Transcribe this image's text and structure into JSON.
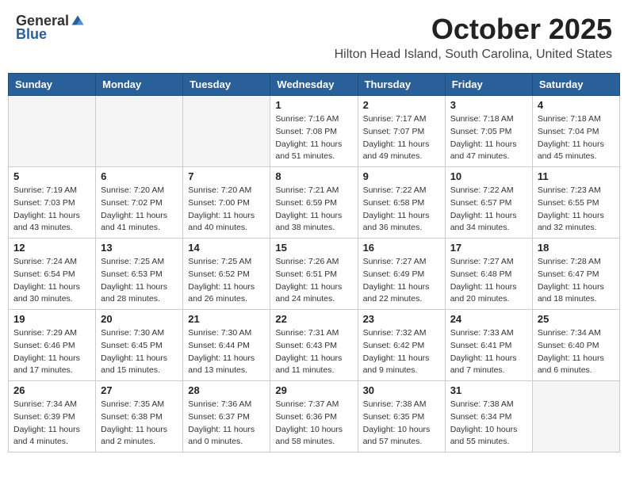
{
  "logo": {
    "general": "General",
    "blue": "Blue"
  },
  "title": "October 2025",
  "location": "Hilton Head Island, South Carolina, United States",
  "days_of_week": [
    "Sunday",
    "Monday",
    "Tuesday",
    "Wednesday",
    "Thursday",
    "Friday",
    "Saturday"
  ],
  "weeks": [
    [
      {
        "day": "",
        "info": ""
      },
      {
        "day": "",
        "info": ""
      },
      {
        "day": "",
        "info": ""
      },
      {
        "day": "1",
        "info": "Sunrise: 7:16 AM\nSunset: 7:08 PM\nDaylight: 11 hours\nand 51 minutes."
      },
      {
        "day": "2",
        "info": "Sunrise: 7:17 AM\nSunset: 7:07 PM\nDaylight: 11 hours\nand 49 minutes."
      },
      {
        "day": "3",
        "info": "Sunrise: 7:18 AM\nSunset: 7:05 PM\nDaylight: 11 hours\nand 47 minutes."
      },
      {
        "day": "4",
        "info": "Sunrise: 7:18 AM\nSunset: 7:04 PM\nDaylight: 11 hours\nand 45 minutes."
      }
    ],
    [
      {
        "day": "5",
        "info": "Sunrise: 7:19 AM\nSunset: 7:03 PM\nDaylight: 11 hours\nand 43 minutes."
      },
      {
        "day": "6",
        "info": "Sunrise: 7:20 AM\nSunset: 7:02 PM\nDaylight: 11 hours\nand 41 minutes."
      },
      {
        "day": "7",
        "info": "Sunrise: 7:20 AM\nSunset: 7:00 PM\nDaylight: 11 hours\nand 40 minutes."
      },
      {
        "day": "8",
        "info": "Sunrise: 7:21 AM\nSunset: 6:59 PM\nDaylight: 11 hours\nand 38 minutes."
      },
      {
        "day": "9",
        "info": "Sunrise: 7:22 AM\nSunset: 6:58 PM\nDaylight: 11 hours\nand 36 minutes."
      },
      {
        "day": "10",
        "info": "Sunrise: 7:22 AM\nSunset: 6:57 PM\nDaylight: 11 hours\nand 34 minutes."
      },
      {
        "day": "11",
        "info": "Sunrise: 7:23 AM\nSunset: 6:55 PM\nDaylight: 11 hours\nand 32 minutes."
      }
    ],
    [
      {
        "day": "12",
        "info": "Sunrise: 7:24 AM\nSunset: 6:54 PM\nDaylight: 11 hours\nand 30 minutes."
      },
      {
        "day": "13",
        "info": "Sunrise: 7:25 AM\nSunset: 6:53 PM\nDaylight: 11 hours\nand 28 minutes."
      },
      {
        "day": "14",
        "info": "Sunrise: 7:25 AM\nSunset: 6:52 PM\nDaylight: 11 hours\nand 26 minutes."
      },
      {
        "day": "15",
        "info": "Sunrise: 7:26 AM\nSunset: 6:51 PM\nDaylight: 11 hours\nand 24 minutes."
      },
      {
        "day": "16",
        "info": "Sunrise: 7:27 AM\nSunset: 6:49 PM\nDaylight: 11 hours\nand 22 minutes."
      },
      {
        "day": "17",
        "info": "Sunrise: 7:27 AM\nSunset: 6:48 PM\nDaylight: 11 hours\nand 20 minutes."
      },
      {
        "day": "18",
        "info": "Sunrise: 7:28 AM\nSunset: 6:47 PM\nDaylight: 11 hours\nand 18 minutes."
      }
    ],
    [
      {
        "day": "19",
        "info": "Sunrise: 7:29 AM\nSunset: 6:46 PM\nDaylight: 11 hours\nand 17 minutes."
      },
      {
        "day": "20",
        "info": "Sunrise: 7:30 AM\nSunset: 6:45 PM\nDaylight: 11 hours\nand 15 minutes."
      },
      {
        "day": "21",
        "info": "Sunrise: 7:30 AM\nSunset: 6:44 PM\nDaylight: 11 hours\nand 13 minutes."
      },
      {
        "day": "22",
        "info": "Sunrise: 7:31 AM\nSunset: 6:43 PM\nDaylight: 11 hours\nand 11 minutes."
      },
      {
        "day": "23",
        "info": "Sunrise: 7:32 AM\nSunset: 6:42 PM\nDaylight: 11 hours\nand 9 minutes."
      },
      {
        "day": "24",
        "info": "Sunrise: 7:33 AM\nSunset: 6:41 PM\nDaylight: 11 hours\nand 7 minutes."
      },
      {
        "day": "25",
        "info": "Sunrise: 7:34 AM\nSunset: 6:40 PM\nDaylight: 11 hours\nand 6 minutes."
      }
    ],
    [
      {
        "day": "26",
        "info": "Sunrise: 7:34 AM\nSunset: 6:39 PM\nDaylight: 11 hours\nand 4 minutes."
      },
      {
        "day": "27",
        "info": "Sunrise: 7:35 AM\nSunset: 6:38 PM\nDaylight: 11 hours\nand 2 minutes."
      },
      {
        "day": "28",
        "info": "Sunrise: 7:36 AM\nSunset: 6:37 PM\nDaylight: 11 hours\nand 0 minutes."
      },
      {
        "day": "29",
        "info": "Sunrise: 7:37 AM\nSunset: 6:36 PM\nDaylight: 10 hours\nand 58 minutes."
      },
      {
        "day": "30",
        "info": "Sunrise: 7:38 AM\nSunset: 6:35 PM\nDaylight: 10 hours\nand 57 minutes."
      },
      {
        "day": "31",
        "info": "Sunrise: 7:38 AM\nSunset: 6:34 PM\nDaylight: 10 hours\nand 55 minutes."
      },
      {
        "day": "",
        "info": ""
      }
    ]
  ]
}
